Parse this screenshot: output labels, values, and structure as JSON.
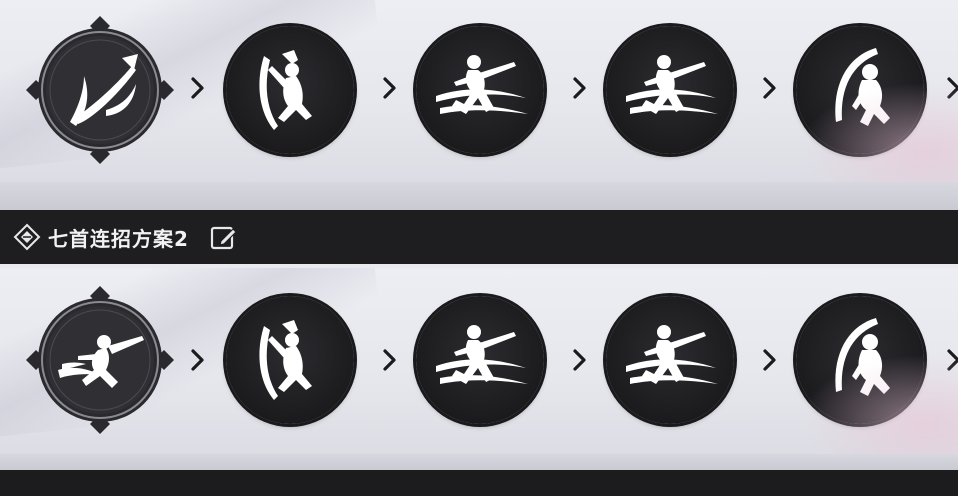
{
  "plan2": {
    "title": "七首连招方案2"
  },
  "icons": {
    "plan_marker": "diamond-emblem-icon",
    "edit": "edit-icon",
    "arrow": "chevron-right-icon"
  },
  "row1": {
    "start_skill": "dagger-weapon-icon",
    "skills": [
      "crouching-slash-icon",
      "leaping-slash-icon",
      "leaping-slash-icon",
      "rising-crescent-icon"
    ]
  },
  "row2": {
    "start_skill": "dash-strike-icon",
    "skills": [
      "crouching-slash-icon",
      "leaping-slash-icon",
      "leaping-slash-icon",
      "rising-crescent-icon"
    ]
  },
  "colors": {
    "bar": "#1e1e21",
    "icon_bg": "#1b1b1e",
    "icon_fg": "#ffffff",
    "panel": "#e9e9ee"
  }
}
